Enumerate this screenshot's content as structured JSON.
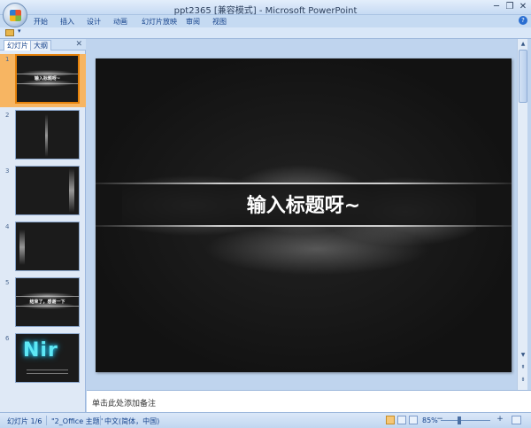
{
  "window": {
    "title": "ppt2365 [兼容模式] - Microsoft PowerPoint",
    "minimize": "─",
    "restore": "❐",
    "close": "✕"
  },
  "ribbon": {
    "tabs": [
      "开始",
      "插入",
      "设计",
      "动画",
      "幻灯片放映",
      "审阅",
      "视图"
    ],
    "help": "?"
  },
  "qat": {
    "dropdown": "▾"
  },
  "left_panel": {
    "tabs": [
      "幻灯片",
      "大纲"
    ],
    "close": "✕",
    "thumbnails": [
      {
        "num": "1",
        "label": "输入标题呀~"
      },
      {
        "num": "2",
        "label": ""
      },
      {
        "num": "3",
        "label": ""
      },
      {
        "num": "4",
        "label": ""
      },
      {
        "num": "5",
        "label": "结束了，感谢一下"
      },
      {
        "num": "6",
        "label": "Nir"
      }
    ]
  },
  "slide": {
    "title": "输入标题呀~"
  },
  "scrollbar": {
    "up": "▲",
    "down": "▼",
    "prev": "⇞",
    "next": "⇟"
  },
  "notes": {
    "placeholder": "单击此处添加备注"
  },
  "status": {
    "slide_count": "幻灯片 1/6",
    "theme": "\"2_Office 主题\"",
    "language": "中文(简体，中国)",
    "zoom": "85%",
    "zoom_minus": "−",
    "zoom_plus": "+"
  },
  "colors": {
    "selected_thumb": "#f7b562",
    "slide_bg": "#161616",
    "chrome": "#bfd4ee"
  }
}
